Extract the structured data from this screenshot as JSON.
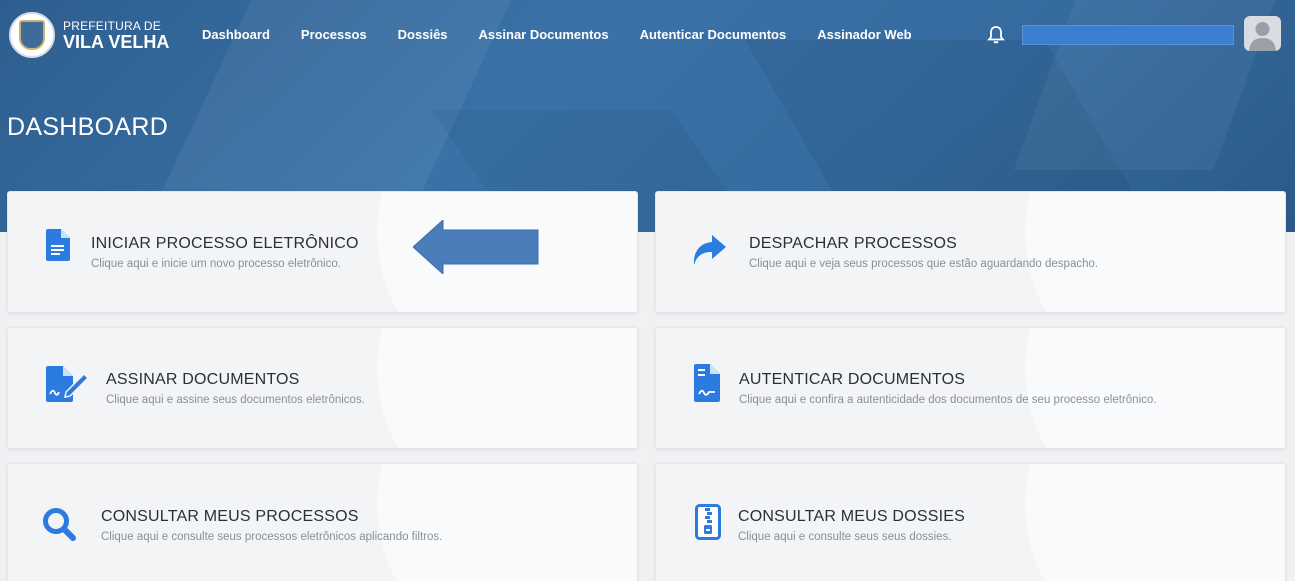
{
  "header": {
    "logo_line1": "PREFEITURA DE",
    "logo_line2": "VILA VELHA",
    "nav": [
      {
        "label": "Dashboard"
      },
      {
        "label": "Processos"
      },
      {
        "label": "Dossiês"
      },
      {
        "label": "Assinar Documentos"
      },
      {
        "label": "Autenticar Documentos"
      },
      {
        "label": "Assinador Web"
      }
    ],
    "notification_icon": "bell-icon",
    "user_name_field": "",
    "avatar_icon": "user-avatar-icon"
  },
  "page": {
    "title": "DASHBOARD"
  },
  "cards": [
    {
      "title": "INICIAR PROCESSO ELETRÔNICO",
      "desc": "Clique aqui e inicie um novo processo eletrônico.",
      "icon": "document-icon"
    },
    {
      "title": "DESPACHAR PROCESSOS",
      "desc": "Clique aqui e veja seus processos que estão aguardando despacho.",
      "icon": "share-arrow-icon"
    },
    {
      "title": "ASSINAR DOCUMENTOS",
      "desc": "Clique aqui e assine seus documentos eletrônicos.",
      "icon": "sign-document-icon"
    },
    {
      "title": "AUTENTICAR DOCUMENTOS",
      "desc": "Clique aqui e confira a autenticidade dos documentos de seu processo eletrônico.",
      "icon": "authenticate-document-icon"
    },
    {
      "title": "CONSULTAR MEUS PROCESSOS",
      "desc": "Clique aqui e consulte seus processos eletrônicos aplicando filtros.",
      "icon": "search-icon"
    },
    {
      "title": "CONSULTAR MEUS DOSSIES",
      "desc": "Clique aqui e consulte seus seus dossies.",
      "icon": "zip-file-icon"
    }
  ],
  "colors": {
    "brand_blue": "#2f6196",
    "icon_blue": "#2b7be0",
    "annotation_arrow": "#4b7dbb"
  }
}
